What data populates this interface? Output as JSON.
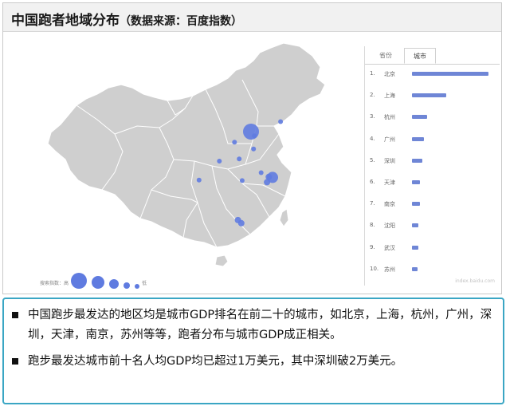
{
  "header": {
    "title": "中国跑者地域分布",
    "subtitle": "（数据来源：百度指数）"
  },
  "colors": {
    "map_fill": "#cfcfcf",
    "map_border": "#ffffff",
    "bubble": "#5f7be0",
    "bar": "#6f86d6",
    "notes_border": "#3aa6c4"
  },
  "panel": {
    "tabs": [
      "省份",
      "城市"
    ],
    "active_tab": "城市",
    "watermark": "index.baidu.com"
  },
  "legend": {
    "label": "搜索指数：高",
    "low_label": "低",
    "sizes": [
      10,
      8,
      6,
      4,
      3
    ]
  },
  "chart_data": {
    "type": "bar",
    "title": "",
    "categories": [
      "北京",
      "上海",
      "杭州",
      "广州",
      "深圳",
      "天津",
      "南京",
      "沈阳",
      "武汉",
      "苏州"
    ],
    "ranks": [
      "1.",
      "2.",
      "3.",
      "4.",
      "5.",
      "6.",
      "7.",
      "8.",
      "9.",
      "10."
    ],
    "values": [
      100,
      45,
      20,
      16,
      14,
      10,
      10,
      8,
      8,
      7
    ],
    "ylim": [
      0,
      100
    ],
    "grid": false,
    "legend": "bottom-left"
  },
  "map_bubbles": [
    {
      "city": "北京",
      "lon": 116.4,
      "lat": 39.9,
      "size": 10
    },
    {
      "city": "沈阳",
      "lon": 123.4,
      "lat": 41.8,
      "size": 3
    },
    {
      "city": "天津",
      "lon": 117.2,
      "lat": 39.1,
      "size": 3
    },
    {
      "city": "太原",
      "lon": 112.5,
      "lat": 37.9,
      "size": 3
    },
    {
      "city": "济南",
      "lon": 117.0,
      "lat": 36.6,
      "size": 3
    },
    {
      "city": "西安",
      "lon": 108.9,
      "lat": 34.3,
      "size": 3
    },
    {
      "city": "郑州",
      "lon": 113.6,
      "lat": 34.7,
      "size": 3
    },
    {
      "city": "南京",
      "lon": 118.8,
      "lat": 32.1,
      "size": 3
    },
    {
      "city": "武汉",
      "lon": 114.3,
      "lat": 30.6,
      "size": 3
    },
    {
      "city": "上海",
      "lon": 121.5,
      "lat": 31.2,
      "size": 7
    },
    {
      "city": "苏州",
      "lon": 120.6,
      "lat": 31.3,
      "size": 4
    },
    {
      "city": "杭州",
      "lon": 120.2,
      "lat": 30.3,
      "size": 4
    },
    {
      "city": "成都",
      "lon": 104.1,
      "lat": 30.7,
      "size": 3
    },
    {
      "city": "广州",
      "lon": 113.3,
      "lat": 23.1,
      "size": 4
    },
    {
      "city": "深圳",
      "lon": 114.1,
      "lat": 22.5,
      "size": 4
    }
  ],
  "notes": [
    "中国跑步最发达的地区均是城市GDP排名在前二十的城市，如北京，上海，杭州，广州，深圳，天津，南京，苏州等等，跑者分布与城市GDP成正相关。",
    "跑步最发达城市前十名人均GDP均已超过1万美元，其中深圳破2万美元。"
  ]
}
